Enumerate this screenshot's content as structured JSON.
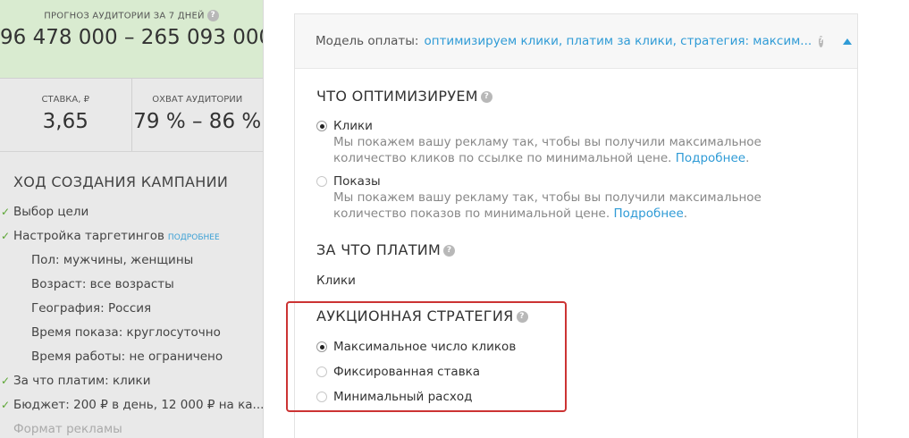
{
  "sidebar": {
    "forecast": {
      "label": "ПРОГНОЗ АУДИТОРИИ ЗА 7 ДНЕЙ",
      "value": "96 478 000 – 265 093 000"
    },
    "bid": {
      "label": "СТАВКА, ₽",
      "value": "3,65"
    },
    "reach": {
      "label": "ОХВАТ АУДИТОРИИ",
      "value": "79 % – 86 %"
    },
    "progress_title": "ХОД СОЗДАНИЯ КАМПАНИИ",
    "more_link": "ПОДРОБНЕЕ",
    "items": [
      {
        "text": "Выбор цели",
        "done": true
      },
      {
        "text": "Настройка таргетингов",
        "done": true,
        "has_link": true
      },
      {
        "text": "Пол: мужчины, женщины",
        "sub": true
      },
      {
        "text": "Возраст: все возрасты",
        "sub": true
      },
      {
        "text": "География: Россия",
        "sub": true
      },
      {
        "text": "Время показа: круглосуточно",
        "sub": true
      },
      {
        "text": "Время работы: не ограничено",
        "sub": true
      },
      {
        "text": "За что платим: клики",
        "done": true
      },
      {
        "text": "Бюджет: 200 ₽ в день, 12 000 ₽ на ка...",
        "done": true
      },
      {
        "text": "Формат рекламы",
        "faded": true
      }
    ]
  },
  "panel": {
    "header_label": "Модель оплаты:",
    "header_value": "оптимизируем клики, платим за клики, стратегия: максим...",
    "optimize": {
      "title": "ЧТО ОПТИМИЗИРУЕМ",
      "options": [
        {
          "label": "Клики",
          "desc": "Мы покажем вашу рекламу так, чтобы вы получили максимальное количество кликов по ссылке по минимальной цене.",
          "link": "Подробнее",
          "checked": true
        },
        {
          "label": "Показы",
          "desc": "Мы покажем вашу рекламу так, чтобы вы получили максимальное количество показов по минимальной цене.",
          "link": "Подробнее",
          "checked": false
        }
      ]
    },
    "pay_for": {
      "title": "ЗА ЧТО ПЛАТИМ",
      "value": "Клики"
    },
    "strategy": {
      "title": "АУКЦИОННАЯ СТРАТЕГИЯ",
      "options": [
        {
          "label": "Максимальное число кликов",
          "checked": true
        },
        {
          "label": "Фиксированная ставка",
          "checked": false
        },
        {
          "label": "Минимальный расход",
          "checked": false
        }
      ]
    },
    "help_glyph": "?",
    "period": "."
  },
  "colors": {
    "forecast_bg": "#d9ebd0",
    "sidebar_bg": "#e9e9e9",
    "link": "#2f9bd6",
    "check": "#5aa532",
    "highlight": "#cc3333"
  }
}
